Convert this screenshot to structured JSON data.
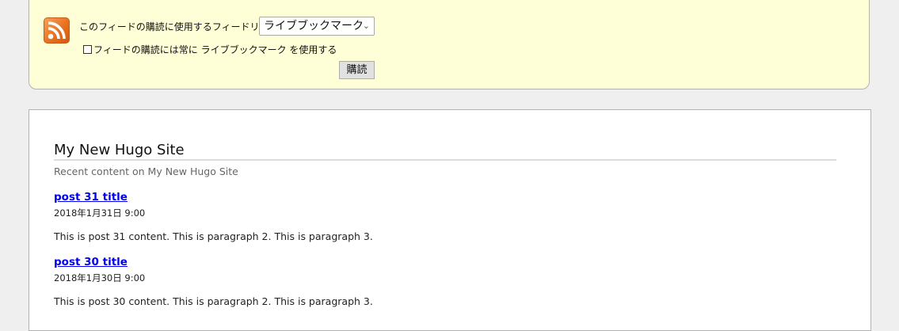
{
  "subscribe_panel": {
    "feed_reader_label": "このフィードの購読に使用するフィードリーダー:",
    "selected_reader": "ライブブックマーク",
    "always_use_label": "フィードの購読には常に ライブブックマーク を使用する",
    "always_use_checked": false,
    "subscribe_button": "購読",
    "feed_icon_color": "#e8711f",
    "background_color": "#ffffd7"
  },
  "feed": {
    "title": "My New Hugo Site",
    "subtitle": "Recent content on My New Hugo Site",
    "link_color": "#0000ee",
    "items": [
      {
        "title": "post 31 title",
        "date": "2018年1月31日 9:00",
        "content": "This is post 31 content. This is paragraph 2. This is paragraph 3."
      },
      {
        "title": "post 30 title",
        "date": "2018年1月30日 9:00",
        "content": "This is post 30 content. This is paragraph 2. This is paragraph 3."
      }
    ]
  }
}
